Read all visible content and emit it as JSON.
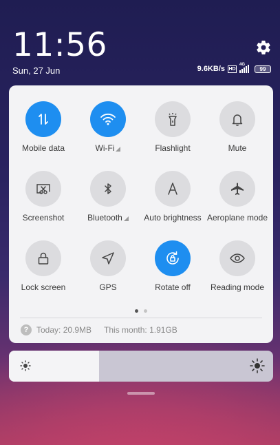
{
  "status": {
    "time": "11:56",
    "date": "Sun, 27 Jun",
    "net_speed": "9.6KB/s",
    "hd_label": "HD",
    "signal_label": "4G",
    "battery": "99"
  },
  "tiles": [
    {
      "label": "Mobile data",
      "icon": "mobile-data-icon",
      "active": true
    },
    {
      "label": "Wi-Fi",
      "icon": "wifi-icon",
      "active": true
    },
    {
      "label": "Flashlight",
      "icon": "flashlight-icon",
      "active": false
    },
    {
      "label": "Mute",
      "icon": "bell-icon",
      "active": false
    },
    {
      "label": "Screenshot",
      "icon": "screenshot-icon",
      "active": false
    },
    {
      "label": "Bluetooth",
      "icon": "bluetooth-icon",
      "active": false
    },
    {
      "label": "Auto brightness",
      "icon": "auto-brightness-icon",
      "active": false
    },
    {
      "label": "Aeroplane mode",
      "icon": "aeroplane-icon",
      "active": false
    },
    {
      "label": "Lock screen",
      "icon": "lock-icon",
      "active": false
    },
    {
      "label": "GPS",
      "icon": "location-arrow-icon",
      "active": false
    },
    {
      "label": "Rotate off",
      "icon": "rotate-lock-icon",
      "active": true
    },
    {
      "label": "Reading mode",
      "icon": "eye-icon",
      "active": false
    }
  ],
  "pages": {
    "current": 1,
    "total": 2
  },
  "usage": {
    "today": "Today: 20.9MB",
    "month": "This month: 1.91GB"
  },
  "brightness": {
    "level": 0.34
  },
  "colors": {
    "accent": "#1e8ef0",
    "tile_off": "#dcdcdf",
    "panel": "#f3f3f5"
  }
}
